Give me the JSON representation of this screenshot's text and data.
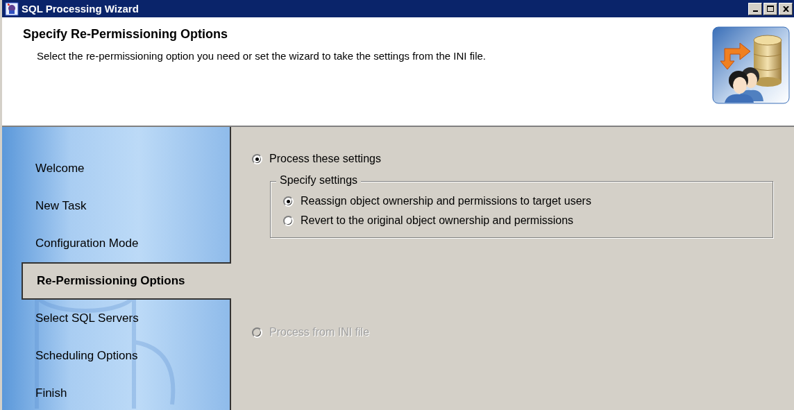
{
  "window": {
    "title": "SQL Processing Wizard"
  },
  "header": {
    "title": "Specify Re-Permissioning Options",
    "description": "Select the re-permissioning option you need or set the wizard to take the settings from the INI file."
  },
  "sidebar": {
    "items": [
      {
        "label": "Welcome",
        "selected": false
      },
      {
        "label": "New Task",
        "selected": false
      },
      {
        "label": "Configuration Mode",
        "selected": false
      },
      {
        "label": "Re-Permissioning Options",
        "selected": true
      },
      {
        "label": "Select SQL Servers",
        "selected": false
      },
      {
        "label": "Scheduling Options",
        "selected": false
      },
      {
        "label": "Finish",
        "selected": false
      }
    ]
  },
  "options": [
    {
      "label": "Process these settings",
      "selected": true,
      "disabled": false
    },
    {
      "label": "Process from INI file",
      "selected": false,
      "disabled": true
    }
  ],
  "settings_group": {
    "title": "Specify settings",
    "options": [
      {
        "label": "Reassign object ownership and permissions to target users",
        "selected": true,
        "disabled": false
      },
      {
        "label": "Revert to the original object ownership and permissions",
        "selected": false,
        "disabled": false
      }
    ]
  }
}
